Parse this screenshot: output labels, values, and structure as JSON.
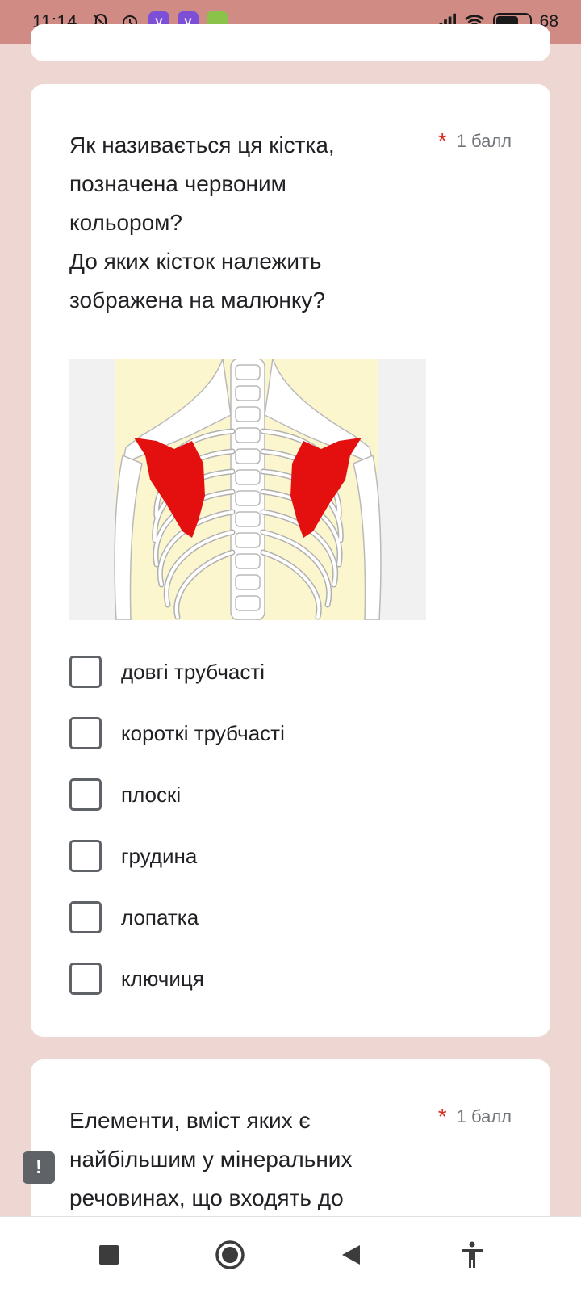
{
  "status_bar": {
    "time": "11:14",
    "battery": "68",
    "icons": [
      "notifications-off-icon",
      "alarm-icon",
      "viber-icon",
      "viber-icon",
      "app-icon",
      "signal-icon",
      "wifi-icon",
      "battery-icon"
    ]
  },
  "question1": {
    "title_lines": [
      "Як називається ця кістка,",
      "позначена червоним",
      "кольором?",
      "До яких кісток належить",
      "зображена на малюнку?"
    ],
    "required_mark": "*",
    "points": "1 балл",
    "options": [
      "довгі трубчасті",
      "короткі трубчасті",
      "плоскі",
      "грудина",
      "лопатка",
      "ключиця"
    ]
  },
  "question2": {
    "title_lines": [
      "Елементи, вміст яких є",
      "найбільшим у мінеральних",
      "речовинах, що входять до"
    ],
    "required_mark": "*",
    "points": "1 балл"
  },
  "feedback": {
    "label": "!"
  },
  "colors": {
    "background": "#eed6d2",
    "status_bar": "#cf8b84",
    "required": "#d93025",
    "highlight_bone": "#e41010"
  }
}
